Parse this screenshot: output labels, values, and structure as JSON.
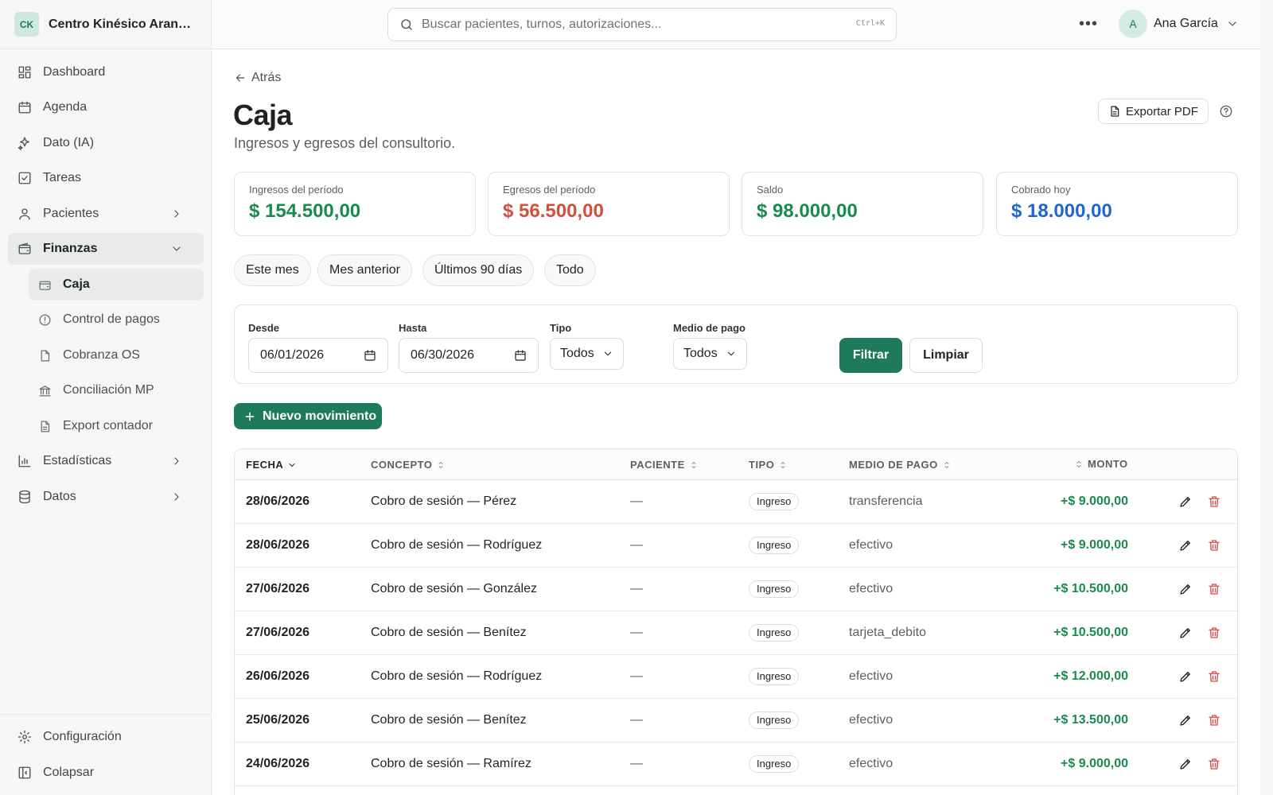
{
  "brand": {
    "initials": "CK",
    "name": "Centro Kinésico Aranguren"
  },
  "search": {
    "placeholder": "Buscar pacientes, turnos, autorizaciones...",
    "shortcut": "Ctrl+K"
  },
  "user": {
    "initial": "A",
    "name": "Ana García"
  },
  "sidebar": {
    "items": [
      {
        "label": "Dashboard",
        "icon": "dashboard-icon"
      },
      {
        "label": "Agenda",
        "icon": "calendar-icon"
      },
      {
        "label": "Dato (IA)",
        "icon": "sparkle-icon"
      },
      {
        "label": "Tareas",
        "icon": "checkbox-icon"
      },
      {
        "label": "Pacientes",
        "icon": "user-icon"
      },
      {
        "label": "Finanzas",
        "icon": "wallet-icon"
      }
    ],
    "sub_items": [
      {
        "label": "Caja",
        "icon": "wallet-icon"
      },
      {
        "label": "Control de pagos",
        "icon": "alert-circle-icon"
      },
      {
        "label": "Cobranza OS",
        "icon": "file-icon"
      },
      {
        "label": "Conciliación MP",
        "icon": "bank-icon"
      },
      {
        "label": "Export contador",
        "icon": "file-text-icon"
      }
    ],
    "items_after": [
      {
        "label": "Estadísticas",
        "icon": "bar-chart-icon"
      },
      {
        "label": "Datos",
        "icon": "database-icon"
      }
    ],
    "footer": [
      {
        "label": "Configuración",
        "icon": "gear-icon"
      },
      {
        "label": "Colapsar",
        "icon": "collapse-icon"
      }
    ]
  },
  "page": {
    "back_label": "Atrás",
    "title": "Caja",
    "subtitle": "Ingresos y egresos del consultorio.",
    "export_label": "Exportar PDF"
  },
  "stats": [
    {
      "label": "Ingresos del período",
      "value": "$ 154.500,00",
      "color": "#1a8a4f"
    },
    {
      "label": "Egresos del período",
      "value": "$ 56.500,00",
      "color": "#d0503c"
    },
    {
      "label": "Saldo",
      "value": "$ 98.000,00",
      "color": "#1a8a4f"
    },
    {
      "label": "Cobrado hoy",
      "value": "$ 18.000,00",
      "color": "#1f66d1"
    }
  ],
  "periods": [
    "Este mes",
    "Mes anterior",
    "Últimos 90 días",
    "Todo"
  ],
  "filters": {
    "desde_label": "Desde",
    "desde_value": "06/01/2026",
    "hasta_label": "Hasta",
    "hasta_value": "06/30/2026",
    "tipo_label": "Tipo",
    "tipo_value": "Todos",
    "medio_label": "Medio de pago",
    "medio_value": "Todos",
    "filter_button": "Filtrar",
    "clear_button": "Limpiar"
  },
  "new_button": "Nuevo movimiento",
  "table": {
    "headers": {
      "fecha": "FECHA",
      "concepto": "CONCEPTO",
      "paciente": "PACIENTE",
      "tipo": "TIPO",
      "medio": "MEDIO DE PAGO",
      "monto": "MONTO"
    },
    "rows": [
      {
        "fecha": "28/06/2026",
        "concepto": "Cobro de sesión — Pérez",
        "paciente": "—",
        "tipo": "Ingreso",
        "medio": "transferencia",
        "monto": "+$ 9.000,00"
      },
      {
        "fecha": "28/06/2026",
        "concepto": "Cobro de sesión — Rodríguez",
        "paciente": "—",
        "tipo": "Ingreso",
        "medio": "efectivo",
        "monto": "+$ 9.000,00"
      },
      {
        "fecha": "27/06/2026",
        "concepto": "Cobro de sesión — González",
        "paciente": "—",
        "tipo": "Ingreso",
        "medio": "efectivo",
        "monto": "+$ 10.500,00"
      },
      {
        "fecha": "27/06/2026",
        "concepto": "Cobro de sesión — Benítez",
        "paciente": "—",
        "tipo": "Ingreso",
        "medio": "tarjeta_debito",
        "monto": "+$ 10.500,00"
      },
      {
        "fecha": "26/06/2026",
        "concepto": "Cobro de sesión — Rodríguez",
        "paciente": "—",
        "tipo": "Ingreso",
        "medio": "efectivo",
        "monto": "+$ 12.000,00"
      },
      {
        "fecha": "25/06/2026",
        "concepto": "Cobro de sesión — Benítez",
        "paciente": "—",
        "tipo": "Ingreso",
        "medio": "efectivo",
        "monto": "+$ 13.500,00"
      },
      {
        "fecha": "24/06/2026",
        "concepto": "Cobro de sesión — Ramírez",
        "paciente": "—",
        "tipo": "Ingreso",
        "medio": "efectivo",
        "monto": "+$ 9.000,00"
      }
    ]
  }
}
